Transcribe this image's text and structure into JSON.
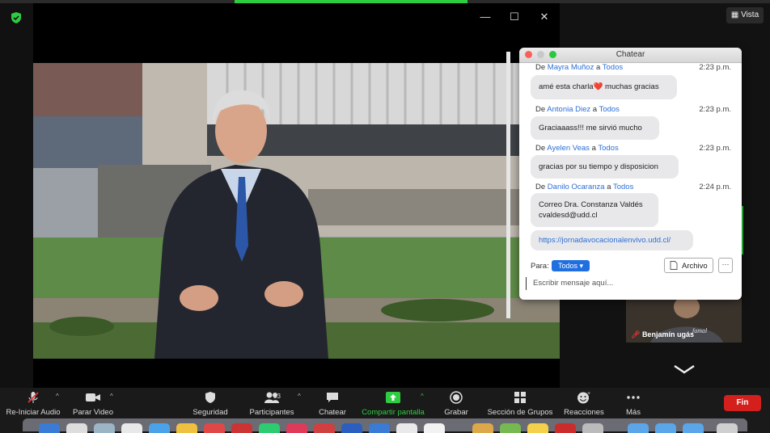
{
  "window": {
    "view_label": "Vista"
  },
  "chat": {
    "title": "Chatear",
    "messages": [
      {
        "from_prefix": "De",
        "sender": "Mayra Muñoz",
        "to_prefix": "a",
        "recipient": "Todos",
        "time": "2:23 p.m.",
        "text": "amé esta charla❤️ muchas gracias"
      },
      {
        "from_prefix": "De",
        "sender": "Antonia Diez",
        "to_prefix": "a",
        "recipient": "Todos",
        "time": "2:23 p.m.",
        "text": "Graciaaass!!! me sirvió mucho"
      },
      {
        "from_prefix": "De",
        "sender": "Ayelen Veas",
        "to_prefix": "a",
        "recipient": "Todos",
        "time": "2:23 p.m.",
        "text": "gracias por su tiempo y disposicion"
      },
      {
        "from_prefix": "De",
        "sender": "Danilo Ocaranza",
        "to_prefix": "a",
        "recipient": "Todos",
        "time": "2:24 p.m.",
        "text_line1": "Correo Dra. Constanza Valdés",
        "text_line2": "cvaldesd@udd.cl"
      },
      {
        "link": "https://jornadavocacionalenvivo.udd.cl/"
      }
    ],
    "to_label": "Para:",
    "to_value": "Todos",
    "file_button": "Archivo",
    "more_button": "···",
    "input_placeholder": "Escribir mensaje aquí..."
  },
  "participant_thumb": {
    "name": "Benjamín ugás"
  },
  "toolbar": {
    "audio": "Re-Iniciar Audio",
    "video": "Parar Video",
    "security": "Seguridad",
    "participants": "Participantes",
    "participants_count": "33",
    "chat": "Chatear",
    "share": "Compartir pantalla",
    "record": "Grabar",
    "groups": "Sección de Grupos",
    "reactions": "Reacciones",
    "more": "Más",
    "end": "Fin"
  },
  "colors": {
    "accent_green": "#2ecc40",
    "end_red": "#d3201d",
    "link_blue": "#2d6fd6",
    "todos_blue": "#1f6fe0"
  }
}
